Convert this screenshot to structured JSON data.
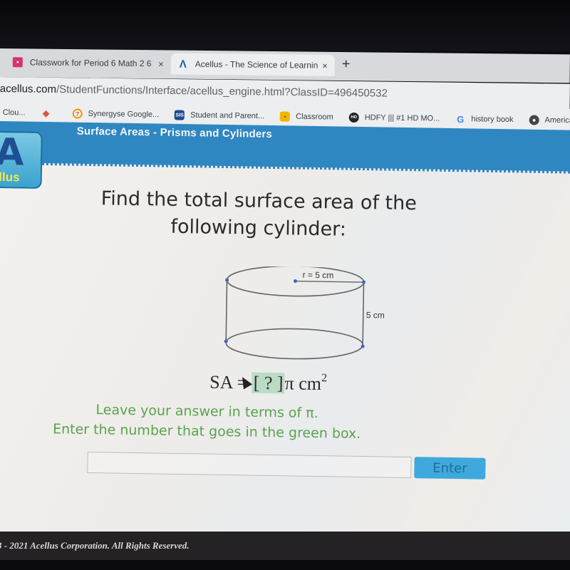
{
  "browser": {
    "tabs": [
      {
        "label": "Classwork for Period 6 Math 2 6",
        "icon": "google-classroom-icon",
        "active": false
      },
      {
        "label": "Acellus - The Science of Learning",
        "icon": "acellus-icon",
        "active": true
      }
    ],
    "close_glyph": "×",
    "new_tab_glyph": "+",
    "url": {
      "domain": "acellus.com",
      "path": "/StudentFunctions/Interface/acellus_engine.html?ClassID=496450532"
    },
    "bookmarks": [
      {
        "label": "Clou...",
        "icon": "none"
      },
      {
        "label": "",
        "icon": "diamond-icon"
      },
      {
        "label": "Synergyse Google...",
        "icon": "synergyse-icon"
      },
      {
        "label": "Student and Parent...",
        "icon": "sis-icon",
        "icon_text": "SIS"
      },
      {
        "label": "Classroom",
        "icon": "google-classroom-icon"
      },
      {
        "label": "HDFY ||| #1 HD MO...",
        "icon": "hd-icon",
        "icon_text": "HD"
      },
      {
        "label": "history book",
        "icon": "google-icon",
        "icon_text": "G"
      },
      {
        "label": "American",
        "icon": "globe-icon"
      }
    ]
  },
  "app": {
    "logo_text": "ellus",
    "logo_mark": "A",
    "unit_title": "Surface Areas - Prisms and Cylinders",
    "brand_color": "#2f87c2"
  },
  "question": {
    "line1": "Find the total surface area of the",
    "line2": "following cylinder:",
    "figure": {
      "shape": "cylinder",
      "radius_label": "r = 5 cm",
      "height_label": "5 cm"
    },
    "formula": {
      "prefix": "SA = ",
      "box": "[ ? ]",
      "suffix": "π cm",
      "exponent": "2"
    },
    "instruction1": "Leave your answer in terms of π.",
    "instruction2": "Enter the number that goes in the green box."
  },
  "answer": {
    "value": "",
    "placeholder": "",
    "submit_label": "Enter"
  },
  "footer": {
    "copyright": "3 - 2021 Acellus Corporation.  All Rights Reserved."
  }
}
